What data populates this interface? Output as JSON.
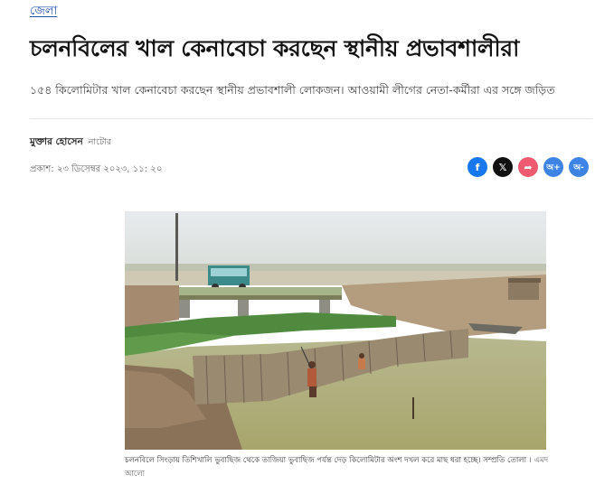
{
  "section": {
    "label": "জেলা"
  },
  "article": {
    "headline": "চলনবিলের খাল কেনাবেচা করছেন স্থানীয় প্রভাবশালীরা",
    "subhead": "১৫৪ কিলোমিটার খাল কেনাবেচা করছেন স্থানীয় প্রভাবশালী লোকজন। আওয়ামী লীগের নেতা-কর্মীরা এর সঙ্গে জড়িত",
    "author": {
      "name": "মুক্তার হোসেন",
      "role": "নাটোর"
    },
    "published": "প্রকাশ: ২৩ ডিসেম্বর ২০২৩, ১১: ২০"
  },
  "share": {
    "facebook_icon": "f",
    "x_icon": "𝕏",
    "share_icon": "➦",
    "font_increase_label": "অ+",
    "font_decrease_label": "অ-"
  },
  "photo": {
    "caption": "চলনবিলে সিংড়ায় তিশিখালি ভুবাছিজ থেকে তাজিয়া ভুবাছিজ পর্যন্ত দেড় কিলোমিটার অংশ দখল করে মাছ ধরা হচ্ছে। সম্প্রতি তোলা ।",
    "credit": "এমদ আলো"
  },
  "colors": {
    "link": "#1f55b5",
    "facebook": "#1877f2",
    "share": "#ee5a6f",
    "font_buttons": "#3d84e6"
  }
}
